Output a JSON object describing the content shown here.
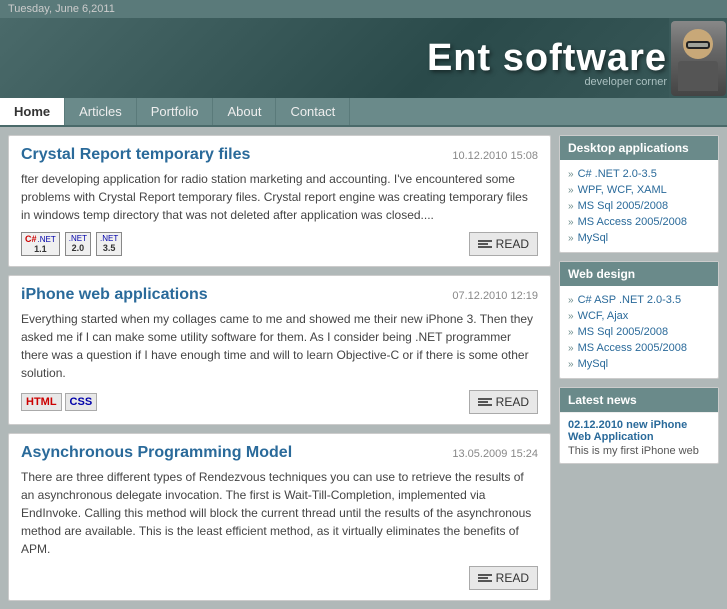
{
  "topbar": {
    "date": "Tuesday, June 6,2011"
  },
  "header": {
    "title": "Ent software",
    "subtitle": "developer corner"
  },
  "nav": {
    "items": [
      {
        "label": "Home",
        "active": true
      },
      {
        "label": "Articles",
        "active": false
      },
      {
        "label": "Portfolio",
        "active": false
      },
      {
        "label": "About",
        "active": false
      },
      {
        "label": "Contact",
        "active": false
      }
    ]
  },
  "articles": [
    {
      "title": "Crystal Report temporary files",
      "date": "10.12.2010 15:08",
      "body": "fter developing application for radio station marketing and accounting. I've encountered some problems with Crystal Report temporary files. Crystal report engine was creating temporary files in windows temp directory that was not deleted after application was closed....",
      "tags": [
        "C# .NET 1.1",
        ".NET 2.0",
        ".NET 3.5"
      ],
      "read_label": "READ"
    },
    {
      "title": "iPhone web applications",
      "date": "07.12.2010 12:19",
      "body": "Everything started when my collages came to me and showed me their new iPhone 3. Then they asked me if I can make some utility software for them. As I consider being .NET programmer there was a question if I have enough time and will to learn Objective-C or if there is some other solution.",
      "tags": [
        "HTML",
        "CSS"
      ],
      "read_label": "READ"
    },
    {
      "title": "Asynchronous Programming Model",
      "date": "13.05.2009 15:24",
      "body": "There are three different types of Rendezvous techniques you can use to retrieve the results of an asynchronous delegate invocation. The first is Wait-Till-Completion, implemented via EndInvoke. Calling this method will block the current thread until the results of the asynchronous method are available. This is the least efficient method, as it virtually eliminates the benefits of APM.",
      "tags": [],
      "read_label": "READ"
    }
  ],
  "sidebar": {
    "desktop_apps": {
      "title": "Desktop applications",
      "links": [
        "C# .NET 2.0-3.5",
        "WPF, WCF, XAML",
        "MS Sql 2005/2008",
        "MS Access 2005/2008",
        "MySql"
      ]
    },
    "web_design": {
      "title": "Web design",
      "links": [
        "C# ASP .NET 2.0-3.5",
        "WCF, Ajax",
        "MS Sql 2005/2008",
        "MS Access 2005/2008",
        "MySql"
      ]
    },
    "latest_news": {
      "title": "Latest news",
      "items": [
        {
          "date": "02.12.2010 new iPhone Web Application",
          "desc": "This is my first iPhone web"
        }
      ]
    }
  }
}
